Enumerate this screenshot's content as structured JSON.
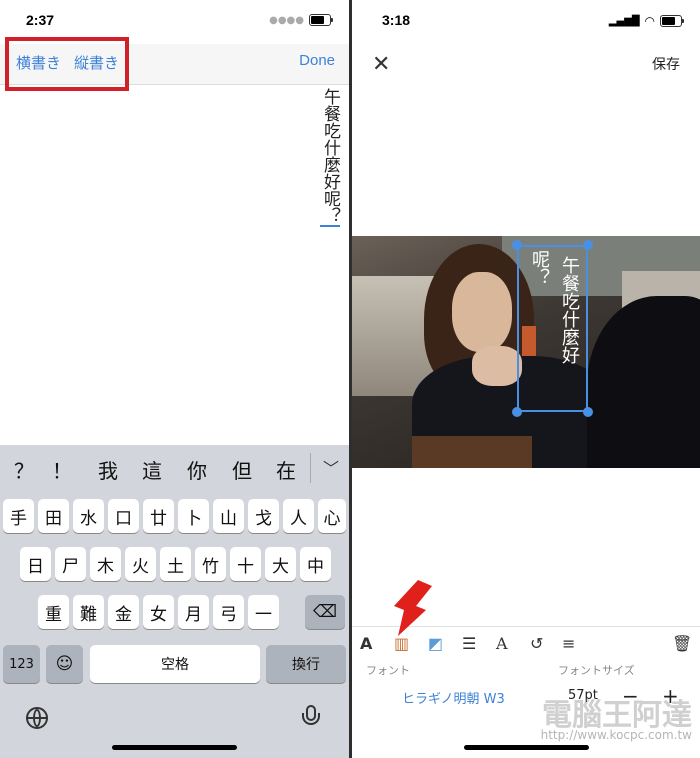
{
  "left": {
    "status_time": "2:37",
    "nav": {
      "horizontal_label": "横書き",
      "vertical_label": "縦書き",
      "done_label": "Done"
    },
    "text_content": "午餐吃什麼好呢？",
    "keyboard": {
      "candidates": [
        "？",
        "！",
        "我",
        "這",
        "你",
        "但",
        "在"
      ],
      "row1": [
        "手",
        "田",
        "水",
        "口",
        "廿",
        "卜",
        "山",
        "戈",
        "人",
        "心"
      ],
      "row2": [
        "日",
        "尸",
        "木",
        "火",
        "土",
        "竹",
        "十",
        "大",
        "中"
      ],
      "row3": [
        "重",
        "難",
        "金",
        "女",
        "月",
        "弓",
        "一"
      ],
      "num_key": "123",
      "space_key": "空格",
      "return_key": "換行"
    }
  },
  "right": {
    "status_time": "3:18",
    "save_label": "保存",
    "overlay_text_col1": "午餐吃什麼好",
    "overlay_text_col2": "呢？",
    "font_label": "フォント",
    "font_size_label": "フォントサイズ",
    "font_name": "ヒラギノ明朝 W3",
    "font_size": "57pt",
    "watermark": "電腦王阿達",
    "watermark_url": "http://www.kocpc.com.tw"
  },
  "colors": {
    "accent": "#3d82d6",
    "highlight": "#d0202a",
    "selection": "#4a90e2"
  }
}
